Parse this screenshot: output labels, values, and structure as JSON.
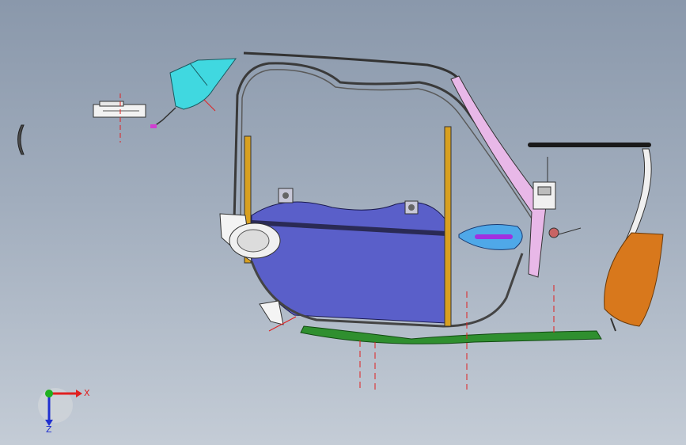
{
  "viewport": {
    "background_top": "#8a98ab",
    "background_bottom": "#c4ccd6"
  },
  "triad": {
    "x_label": "X",
    "z_label": "Z",
    "x_color": "#e02020",
    "y_color": "#20b020",
    "z_color": "#2030d0"
  },
  "colors": {
    "door_panel": "#5a5fc9",
    "window_frame": "#3a3a3a",
    "glass_channel": "#d8a020",
    "sill_strip": "#2f8f2f",
    "mirror_bracket": "#40d8e0",
    "pillar_trim": "#e8b8e8",
    "handle_cover": "#4fa8e8",
    "rear_cap": "#d8781c",
    "hidden_centerline": "#e02020"
  },
  "parts": [
    "door-inner-panel",
    "window-frame",
    "front-glass-channel",
    "rear-glass-channel",
    "lower-sill-strip",
    "mirror-bracket",
    "b-pillar-trim",
    "door-handle",
    "rear-end-cap",
    "speaker-housing",
    "latch-assembly",
    "upper-weatherstrip",
    "rear-rail"
  ]
}
